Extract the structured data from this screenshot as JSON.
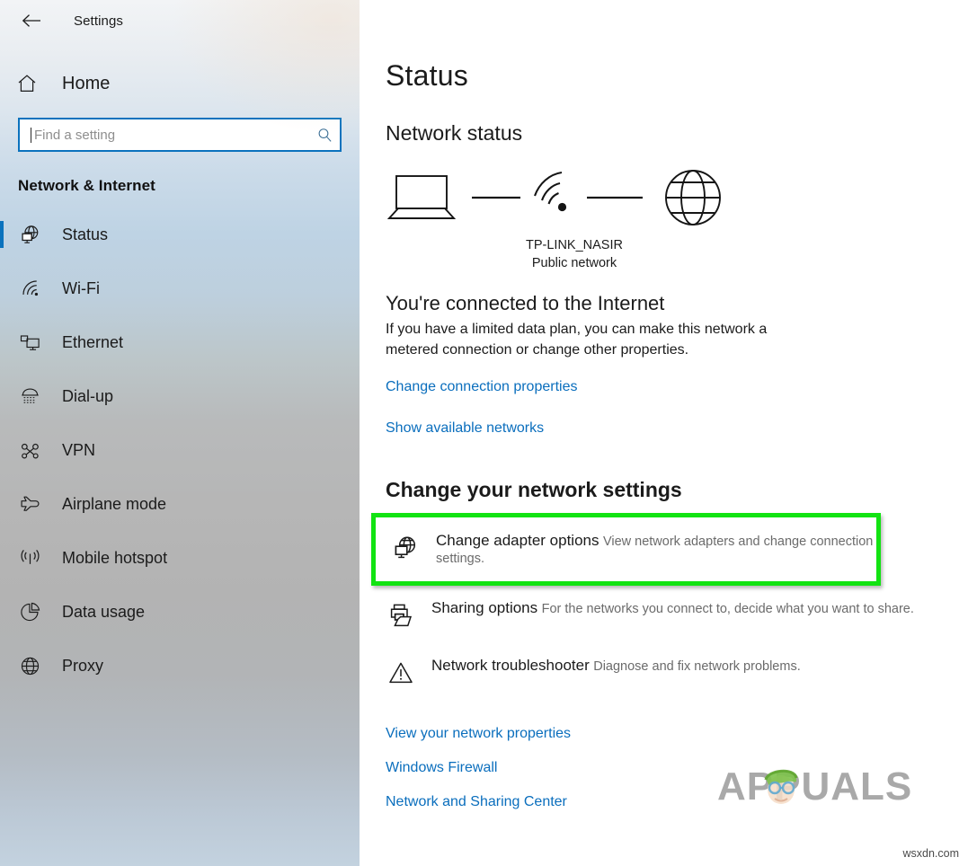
{
  "window": {
    "title": "Settings",
    "back_icon": "back-arrow-icon"
  },
  "sidebar": {
    "home": {
      "label": "Home",
      "icon": "home-icon"
    },
    "search": {
      "value": "",
      "placeholder": "Find a setting",
      "icon": "search-icon"
    },
    "category_heading": "Network & Internet",
    "items": [
      {
        "label": "Status",
        "icon": "globe-monitor-icon",
        "selected": true
      },
      {
        "label": "Wi-Fi",
        "icon": "wifi-icon",
        "selected": false
      },
      {
        "label": "Ethernet",
        "icon": "ethernet-icon",
        "selected": false
      },
      {
        "label": "Dial-up",
        "icon": "dialup-icon",
        "selected": false
      },
      {
        "label": "VPN",
        "icon": "vpn-icon",
        "selected": false
      },
      {
        "label": "Airplane mode",
        "icon": "airplane-icon",
        "selected": false
      },
      {
        "label": "Mobile hotspot",
        "icon": "hotspot-icon",
        "selected": false
      },
      {
        "label": "Data usage",
        "icon": "pie-chart-icon",
        "selected": false
      },
      {
        "label": "Proxy",
        "icon": "globe-icon",
        "selected": false
      }
    ]
  },
  "main": {
    "page_title": "Status",
    "network_status_heading": "Network status",
    "diagram": {
      "device_icon": "laptop-icon",
      "connection_icon": "wifi-icon",
      "internet_icon": "globe-icon",
      "network_name": "TP-LINK_NASIR",
      "network_type": "Public network"
    },
    "connected_title": "You're connected to the Internet",
    "connected_desc": "If you have a limited data plan, you can make this network a metered connection or change other properties.",
    "change_connection_link": "Change connection properties",
    "show_networks_link": "Show available networks",
    "change_settings_heading": "Change your network settings",
    "options": [
      {
        "title": "Change adapter options",
        "desc": "View network adapters and change connection settings.",
        "icon": "globe-monitor-icon",
        "highlighted": true
      },
      {
        "title": "Sharing options",
        "desc": "For the networks you connect to, decide what you want to share.",
        "icon": "printer-folder-icon",
        "highlighted": false
      },
      {
        "title": "Network troubleshooter",
        "desc": "Diagnose and fix network problems.",
        "icon": "warning-triangle-icon",
        "highlighted": false
      }
    ],
    "bottom_links": [
      "View your network properties",
      "Windows Firewall",
      "Network and Sharing Center"
    ]
  },
  "watermark": {
    "brand": "APPUALS",
    "site": "wsxdn.com"
  },
  "colors": {
    "accent_blue": "#0a72bd",
    "link_blue": "#0a6ebd",
    "highlight_green": "#12e312",
    "text_primary": "#1b1b1b",
    "text_secondary": "#6b6b6b"
  }
}
